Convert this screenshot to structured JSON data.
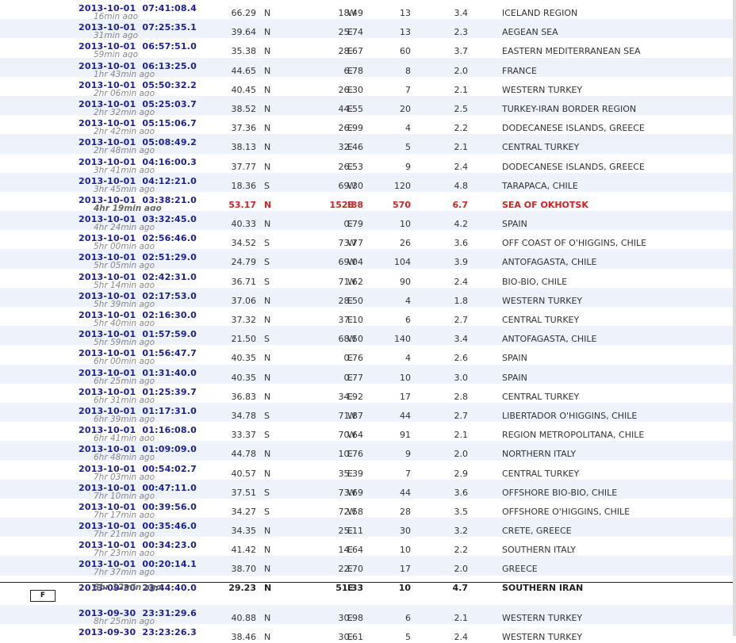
{
  "earthquakes": [
    {
      "datetime": "2013-10-01  07:41:08.4",
      "ago": "16min ago",
      "lat": "66.29",
      "lat_dir": "N",
      "lon": "18.49",
      "lon_dir": "W",
      "depth": "13",
      "mag": "3.4",
      "region": "ICELAND REGION"
    },
    {
      "datetime": "2013-10-01  07:25:35.1",
      "ago": "31min ago",
      "lat": "39.64",
      "lat_dir": "N",
      "lon": "25.74",
      "lon_dir": "E",
      "depth": "13",
      "mag": "2.3",
      "region": "AEGEAN SEA"
    },
    {
      "datetime": "2013-10-01  06:57:51.0",
      "ago": "59min ago",
      "lat": "35.38",
      "lat_dir": "N",
      "lon": "28.67",
      "lon_dir": "E",
      "depth": "60",
      "mag": "3.7",
      "region": "EASTERN MEDITERRANEAN SEA"
    },
    {
      "datetime": "2013-10-01  06:13:25.0",
      "ago": "1hr 43min ago",
      "lat": "44.65",
      "lat_dir": "N",
      "lon": "6.78",
      "lon_dir": "E",
      "depth": "8",
      "mag": "2.0",
      "region": "FRANCE"
    },
    {
      "datetime": "2013-10-01  05:50:32.2",
      "ago": "2hr 06min ago",
      "lat": "40.45",
      "lat_dir": "N",
      "lon": "26.30",
      "lon_dir": "E",
      "depth": "7",
      "mag": "2.1",
      "region": "WESTERN TURKEY"
    },
    {
      "datetime": "2013-10-01  05:25:03.7",
      "ago": "2hr 32min ago",
      "lat": "38.52",
      "lat_dir": "N",
      "lon": "44.55",
      "lon_dir": "E",
      "depth": "20",
      "mag": "2.5",
      "region": "TURKEY-IRAN BORDER REGION"
    },
    {
      "datetime": "2013-10-01  05:15:06.7",
      "ago": "2hr 42min ago",
      "lat": "37.36",
      "lat_dir": "N",
      "lon": "26.99",
      "lon_dir": "E",
      "depth": "4",
      "mag": "2.2",
      "region": "DODECANESE ISLANDS, GREECE"
    },
    {
      "datetime": "2013-10-01  05:08:49.2",
      "ago": "2hr 48min ago",
      "lat": "38.13",
      "lat_dir": "N",
      "lon": "32.46",
      "lon_dir": "E",
      "depth": "5",
      "mag": "2.1",
      "region": "CENTRAL TURKEY"
    },
    {
      "datetime": "2013-10-01  04:16:00.3",
      "ago": "3hr 41min ago",
      "lat": "37.77",
      "lat_dir": "N",
      "lon": "26.53",
      "lon_dir": "E",
      "depth": "9",
      "mag": "2.4",
      "region": "DODECANESE ISLANDS, GREECE"
    },
    {
      "datetime": "2013-10-01  04:12:21.0",
      "ago": "3hr 45min ago",
      "lat": "18.36",
      "lat_dir": "S",
      "lon": "69.30",
      "lon_dir": "W",
      "depth": "120",
      "mag": "4.8",
      "region": "TARAPACA, CHILE"
    },
    {
      "datetime": "2013-10-01  03:38:21.0",
      "ago": "4hr 19min ago",
      "lat": "53.17",
      "lat_dir": "N",
      "lon": "152.88",
      "lon_dir": "E",
      "depth": "570",
      "mag": "6.7",
      "region": "SEA OF OKHOTSK",
      "style": "hl"
    },
    {
      "datetime": "2013-10-01  03:32:45.0",
      "ago": "4hr 24min ago",
      "lat": "40.33",
      "lat_dir": "N",
      "lon": "0.79",
      "lon_dir": "E",
      "depth": "10",
      "mag": "4.2",
      "region": "SPAIN"
    },
    {
      "datetime": "2013-10-01  02:56:46.0",
      "ago": "5hr 00min ago",
      "lat": "34.52",
      "lat_dir": "S",
      "lon": "73.77",
      "lon_dir": "W",
      "depth": "26",
      "mag": "3.6",
      "region": "OFF COAST OF O'HIGGINS, CHILE"
    },
    {
      "datetime": "2013-10-01  02:51:29.0",
      "ago": "5hr 05min ago",
      "lat": "24.79",
      "lat_dir": "S",
      "lon": "69.04",
      "lon_dir": "W",
      "depth": "104",
      "mag": "3.9",
      "region": "ANTOFAGASTA, CHILE"
    },
    {
      "datetime": "2013-10-01  02:42:31.0",
      "ago": "5hr 14min ago",
      "lat": "36.71",
      "lat_dir": "S",
      "lon": "71.62",
      "lon_dir": "W",
      "depth": "90",
      "mag": "2.4",
      "region": "BIO-BIO, CHILE"
    },
    {
      "datetime": "2013-10-01  02:17:53.0",
      "ago": "5hr 39min ago",
      "lat": "37.06",
      "lat_dir": "N",
      "lon": "28.50",
      "lon_dir": "E",
      "depth": "4",
      "mag": "1.8",
      "region": "WESTERN TURKEY"
    },
    {
      "datetime": "2013-10-01  02:16:30.0",
      "ago": "5hr 40min ago",
      "lat": "37.32",
      "lat_dir": "N",
      "lon": "37.10",
      "lon_dir": "E",
      "depth": "6",
      "mag": "2.7",
      "region": "CENTRAL TURKEY"
    },
    {
      "datetime": "2013-10-01  01:57:59.0",
      "ago": "5hr 59min ago",
      "lat": "21.50",
      "lat_dir": "S",
      "lon": "68.50",
      "lon_dir": "W",
      "depth": "140",
      "mag": "3.4",
      "region": "ANTOFAGASTA, CHILE"
    },
    {
      "datetime": "2013-10-01  01:56:47.7",
      "ago": "6hr 00min ago",
      "lat": "40.35",
      "lat_dir": "N",
      "lon": "0.76",
      "lon_dir": "E",
      "depth": "4",
      "mag": "2.6",
      "region": "SPAIN"
    },
    {
      "datetime": "2013-10-01  01:31:40.0",
      "ago": "6hr 25min ago",
      "lat": "40.35",
      "lat_dir": "N",
      "lon": "0.77",
      "lon_dir": "E",
      "depth": "10",
      "mag": "3.0",
      "region": "SPAIN"
    },
    {
      "datetime": "2013-10-01  01:25:39.7",
      "ago": "6hr 31min ago",
      "lat": "36.83",
      "lat_dir": "N",
      "lon": "34.92",
      "lon_dir": "E",
      "depth": "17",
      "mag": "2.8",
      "region": "CENTRAL TURKEY"
    },
    {
      "datetime": "2013-10-01  01:17:31.0",
      "ago": "6hr 39min ago",
      "lat": "34.78",
      "lat_dir": "S",
      "lon": "71.87",
      "lon_dir": "W",
      "depth": "44",
      "mag": "2.7",
      "region": "LIBERTADOR O'HIGGINS, CHILE"
    },
    {
      "datetime": "2013-10-01  01:16:08.0",
      "ago": "6hr 41min ago",
      "lat": "33.37",
      "lat_dir": "S",
      "lon": "70.64",
      "lon_dir": "W",
      "depth": "91",
      "mag": "2.1",
      "region": "REGION METROPOLITANA, CHILE"
    },
    {
      "datetime": "2013-10-01  01:09:09.0",
      "ago": "6hr 48min ago",
      "lat": "44.78",
      "lat_dir": "N",
      "lon": "10.76",
      "lon_dir": "E",
      "depth": "9",
      "mag": "2.0",
      "region": "NORTHERN ITALY"
    },
    {
      "datetime": "2013-10-01  00:54:02.7",
      "ago": "7hr 03min ago",
      "lat": "40.57",
      "lat_dir": "N",
      "lon": "35.39",
      "lon_dir": "E",
      "depth": "7",
      "mag": "2.9",
      "region": "CENTRAL TURKEY"
    },
    {
      "datetime": "2013-10-01  00:47:11.0",
      "ago": "7hr 10min ago",
      "lat": "37.51",
      "lat_dir": "S",
      "lon": "73.69",
      "lon_dir": "W",
      "depth": "44",
      "mag": "3.6",
      "region": "OFFSHORE BIO-BIO, CHILE"
    },
    {
      "datetime": "2013-10-01  00:39:56.0",
      "ago": "7hr 17min ago",
      "lat": "34.27",
      "lat_dir": "S",
      "lon": "72.58",
      "lon_dir": "W",
      "depth": "28",
      "mag": "3.5",
      "region": "OFFSHORE O'HIGGINS, CHILE"
    },
    {
      "datetime": "2013-10-01  00:35:46.0",
      "ago": "7hr 21min ago",
      "lat": "34.35",
      "lat_dir": "N",
      "lon": "25.11",
      "lon_dir": "E",
      "depth": "30",
      "mag": "3.2",
      "region": "CRETE, GREECE"
    },
    {
      "datetime": "2013-10-01  00:34:23.0",
      "ago": "7hr 23min ago",
      "lat": "41.42",
      "lat_dir": "N",
      "lon": "14.64",
      "lon_dir": "E",
      "depth": "10",
      "mag": "2.2",
      "region": "SOUTHERN ITALY"
    },
    {
      "datetime": "2013-10-01  00:20:14.1",
      "ago": "7hr 37min ago",
      "lat": "38.70",
      "lat_dir": "N",
      "lon": "22.70",
      "lon_dir": "E",
      "depth": "17",
      "mag": "2.0",
      "region": "GREECE"
    },
    {
      "datetime": "2013-09-30  23:44:40.0",
      "ago": "8hr 12min ago",
      "lat": "29.23",
      "lat_dir": "N",
      "lon": "51.33",
      "lon_dir": "E",
      "depth": "10",
      "mag": "4.7",
      "region": "SOUTHERN IRAN",
      "style": "strong",
      "flag": "F",
      "sep": true
    },
    {
      "datetime": "2013-09-30  23:31:29.6",
      "ago": "8hr 25min ago",
      "lat": "40.88",
      "lat_dir": "N",
      "lon": "30.98",
      "lon_dir": "E",
      "depth": "6",
      "mag": "2.1",
      "region": "WESTERN TURKEY"
    },
    {
      "datetime": "2013-09-30  23:23:26.3",
      "ago": "",
      "lat": "38.46",
      "lat_dir": "N",
      "lon": "30.61",
      "lon_dir": "E",
      "depth": "5",
      "mag": "2.4",
      "region": "WESTERN TURKEY"
    }
  ]
}
